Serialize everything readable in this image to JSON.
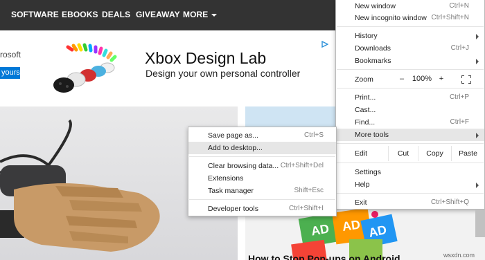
{
  "site": {
    "nav": [
      "SOFTWARE",
      "EBOOKS",
      "DEALS",
      "GIVEAWAY",
      "MORE"
    ],
    "ad": {
      "brand_fragment": "rosoft",
      "button_fragment": "yours",
      "title": "Xbox Design Lab",
      "subtitle": "Design your own personal controller",
      "choices_icon": "ad-choices-icon"
    },
    "article_title": "How to Stop Pop-ups on Android"
  },
  "chrome_menu": {
    "new_window": {
      "label": "New window",
      "shortcut": "Ctrl+N"
    },
    "new_incognito": {
      "label": "New incognito window",
      "shortcut": "Ctrl+Shift+N"
    },
    "history": {
      "label": "History"
    },
    "downloads": {
      "label": "Downloads",
      "shortcut": "Ctrl+J"
    },
    "bookmarks": {
      "label": "Bookmarks"
    },
    "zoom": {
      "label": "Zoom",
      "minus": "–",
      "value": "100%",
      "plus": "+",
      "fullscreen_icon": "fullscreen-icon"
    },
    "print": {
      "label": "Print...",
      "shortcut": "Ctrl+P"
    },
    "cast": {
      "label": "Cast..."
    },
    "find": {
      "label": "Find...",
      "shortcut": "Ctrl+F"
    },
    "more_tools": {
      "label": "More tools"
    },
    "edit": {
      "label": "Edit",
      "cut": "Cut",
      "copy": "Copy",
      "paste": "Paste"
    },
    "settings": {
      "label": "Settings"
    },
    "help": {
      "label": "Help"
    },
    "exit": {
      "label": "Exit",
      "shortcut": "Ctrl+Shift+Q"
    }
  },
  "more_tools_menu": {
    "save_page": {
      "label": "Save page as...",
      "shortcut": "Ctrl+S"
    },
    "add_desktop": {
      "label": "Add to desktop..."
    },
    "clear_data": {
      "label": "Clear browsing data...",
      "shortcut": "Ctrl+Shift+Del"
    },
    "extensions": {
      "label": "Extensions"
    },
    "task_manager": {
      "label": "Task manager",
      "shortcut": "Shift+Esc"
    },
    "dev_tools": {
      "label": "Developer tools",
      "shortcut": "Ctrl+Shift+I"
    }
  },
  "watermark": "wsxdn.com",
  "colors": {
    "nav_bg": "#333333",
    "menu_highlight": "#e6e6e6",
    "ad_button": "#0078d7"
  }
}
